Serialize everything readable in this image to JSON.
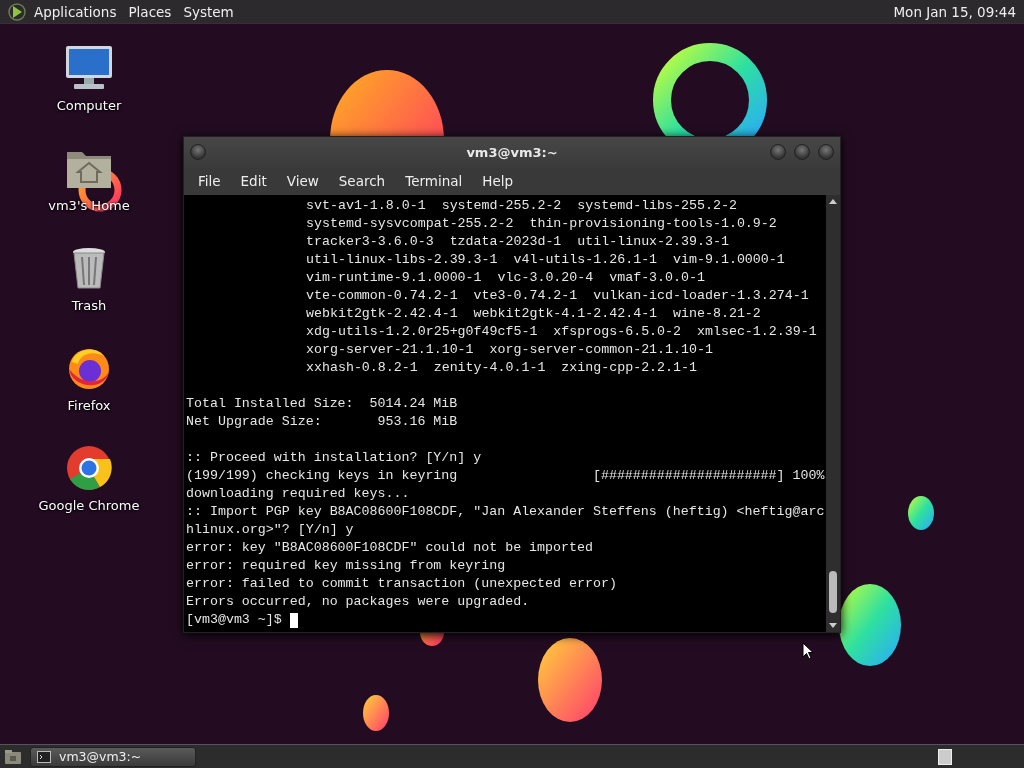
{
  "top_panel": {
    "menus": [
      "Applications",
      "Places",
      "System"
    ],
    "clock": "Mon Jan 15, 09:44"
  },
  "desktop_icons": [
    {
      "kind": "computer",
      "label": "Computer"
    },
    {
      "kind": "home",
      "label": "vm3's Home"
    },
    {
      "kind": "trash",
      "label": "Trash"
    },
    {
      "kind": "firefox",
      "label": "Firefox"
    },
    {
      "kind": "chrome",
      "label": "Google Chrome"
    }
  ],
  "terminal": {
    "title": "vm3@vm3:~",
    "menu": [
      "File",
      "Edit",
      "View",
      "Search",
      "Terminal",
      "Help"
    ],
    "lines": [
      {
        "kind": "package",
        "text": "svt-av1-1.8.0-1  systemd-255.2-2  systemd-libs-255.2-2"
      },
      {
        "kind": "package",
        "text": "systemd-sysvcompat-255.2-2  thin-provisioning-tools-1.0.9-2"
      },
      {
        "kind": "package",
        "text": "tracker3-3.6.0-3  tzdata-2023d-1  util-linux-2.39.3-1"
      },
      {
        "kind": "package",
        "text": "util-linux-libs-2.39.3-1  v4l-utils-1.26.1-1  vim-9.1.0000-1"
      },
      {
        "kind": "package",
        "text": "vim-runtime-9.1.0000-1  vlc-3.0.20-4  vmaf-3.0.0-1"
      },
      {
        "kind": "package",
        "text": "vte-common-0.74.2-1  vte3-0.74.2-1  vulkan-icd-loader-1.3.274-1"
      },
      {
        "kind": "package",
        "text": "webkit2gtk-2.42.4-1  webkit2gtk-4.1-2.42.4-1  wine-8.21-2"
      },
      {
        "kind": "package",
        "text": "xdg-utils-1.2.0r25+g0f49cf5-1  xfsprogs-6.5.0-2  xmlsec-1.2.39-1"
      },
      {
        "kind": "package",
        "text": "xorg-server-21.1.10-1  xorg-server-common-21.1.10-1"
      },
      {
        "kind": "package",
        "text": "xxhash-0.8.2-1  zenity-4.0.1-1  zxing-cpp-2.2.1-1"
      },
      {
        "kind": "blank"
      },
      {
        "kind": "output",
        "text": "Total Installed Size:  5014.24 MiB"
      },
      {
        "kind": "output",
        "text": "Net Upgrade Size:       953.16 MiB"
      },
      {
        "kind": "blank"
      },
      {
        "kind": "output",
        "text": ":: Proceed with installation? [Y/n] y"
      },
      {
        "kind": "output",
        "text": "(199/199) checking keys in keyring                 [######################] 100%"
      },
      {
        "kind": "output",
        "text": "downloading required keys..."
      },
      {
        "kind": "output",
        "text": ":: Import PGP key B8AC08600F108CDF, \"Jan Alexander Steffens (heftig) <heftig@arc"
      },
      {
        "kind": "output",
        "text": "hlinux.org>\"? [Y/n] y"
      },
      {
        "kind": "output",
        "text": "error: key \"B8AC08600F108CDF\" could not be imported"
      },
      {
        "kind": "output",
        "text": "error: required key missing from keyring"
      },
      {
        "kind": "output",
        "text": "error: failed to commit transaction (unexpected error)"
      },
      {
        "kind": "output",
        "text": "Errors occurred, no packages were upgraded."
      }
    ],
    "prompt": "[vm3@vm3 ~]$"
  },
  "taskbar": {
    "tasks": [
      "vm3@vm3:~"
    ]
  }
}
